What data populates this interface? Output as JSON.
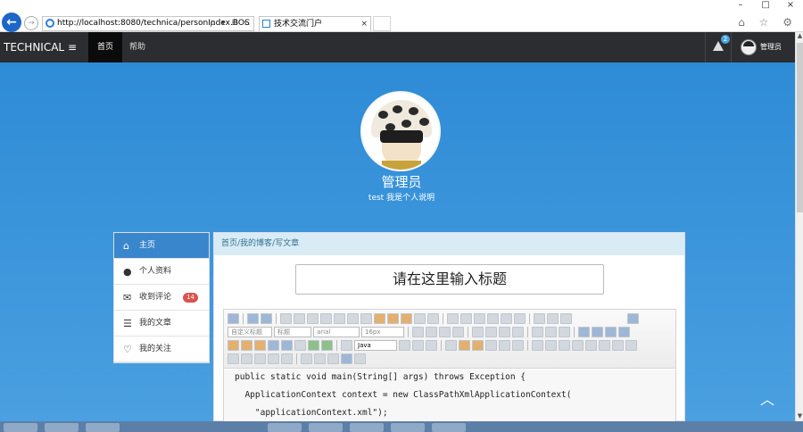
{
  "browser": {
    "url": "http://localhost:8080/technica/personIndex.BOS",
    "address_tools": "ρ ▾ ≣ C",
    "tab_title": "技术交流门户",
    "tab_close": "×",
    "window_controls": [
      "–",
      "□",
      "×"
    ],
    "right_icons": "⌂ ☆ ⚙",
    "back_glyph": "←",
    "fwd_glyph": "→"
  },
  "navbar": {
    "brand": "TECHNICAL",
    "menu_glyph": "≡",
    "items": [
      {
        "label": "首页"
      },
      {
        "label": "帮助"
      }
    ],
    "alert_badge": "2",
    "user_name": "管理员"
  },
  "profile": {
    "name": "管理员",
    "description": "test 我是个人说明"
  },
  "side_menu": {
    "items": [
      {
        "label": "主页",
        "icon": "home-icon",
        "glyph": "⌂"
      },
      {
        "label": "个人资料",
        "icon": "user-icon",
        "glyph": "●"
      },
      {
        "label": "收到评论",
        "icon": "comments-icon",
        "glyph": "✉",
        "badge": "14"
      },
      {
        "label": "我的文章",
        "icon": "list-icon",
        "glyph": "☰"
      },
      {
        "label": "我的关注",
        "icon": "heart-icon",
        "glyph": "♡"
      }
    ]
  },
  "panel": {
    "breadcrumb": "首页/我的博客/写文章",
    "title_placeholder": "请在这里输入标题"
  },
  "editor": {
    "paragraph_select": "自定义标题",
    "heading_select": "标题",
    "font_select": "arial",
    "size_select": "16px",
    "code_language": "Java",
    "code_lines": [
      "public static void main(String[] args) throws Exception {",
      "  ApplicationContext context = new ClassPathXmlApplicationContext(",
      "    \"applicationContext.xml\");"
    ]
  },
  "scroll": {
    "up": "▲",
    "down": "▼"
  },
  "back_to_top": "︿"
}
